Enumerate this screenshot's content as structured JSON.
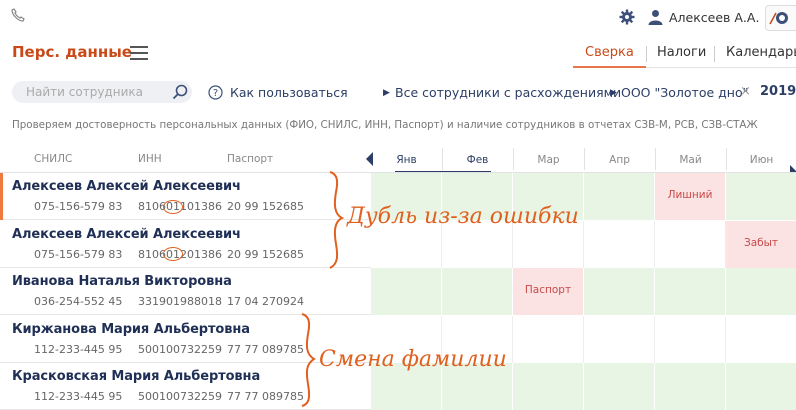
{
  "header": {
    "phone_icon": "phone-icon",
    "user_name": "Алексеев А.А.",
    "settings_icon": "gear-icon",
    "user_icon": "user-icon"
  },
  "nav": {
    "title": "Перс. данные",
    "tabs": [
      {
        "label": "Сверка",
        "active": true
      },
      {
        "label": "Налоги",
        "active": false
      },
      {
        "label": "Календарь",
        "active": false
      }
    ]
  },
  "toolbar": {
    "search_placeholder": "Найти сотрудника",
    "howto_label": "Как пользоваться",
    "filter_label": "Все сотрудники с расхождениями",
    "org_label": "ООО \"Золотое дно\"",
    "clear_symbol": "×",
    "year": "2019"
  },
  "description": "Проверяем достоверность персональных данных (ФИО, СНИЛС, ИНН, Паспорт) и наличие сотрудников в отчетах СЗВ-М, РСВ, СЗВ-СТАЖ",
  "table": {
    "columns": {
      "snils": "СНИЛС",
      "inn": "ИНН",
      "passport": "Паспорт"
    },
    "months": [
      "Янв",
      "Фев",
      "Мар",
      "Апр",
      "Май",
      "Июн"
    ],
    "rows": [
      {
        "name": "Алексеев Алексей Алексеевич",
        "snils": "075-156-579 83",
        "inn": "810601101386",
        "passport": "20 99 152685",
        "cells": [
          "green",
          "green",
          "green",
          "green",
          "red",
          "green"
        ],
        "labels": [
          "",
          "",
          "",
          "",
          "Лишний",
          ""
        ]
      },
      {
        "name": "Алексеев Алексей Алексеевич",
        "snils": "075-156-579 83",
        "inn": "810601201386",
        "passport": "20 99 152685",
        "cells": [
          "white",
          "white",
          "white",
          "white",
          "white",
          "red"
        ],
        "labels": [
          "",
          "",
          "",
          "",
          "",
          "Забыт"
        ]
      },
      {
        "name": "Иванова Наталья Викторовна",
        "snils": "036-254-552 45",
        "inn": "331901988018",
        "passport": "17 04 270924",
        "cells": [
          "green",
          "green",
          "red",
          "green",
          "green",
          "green"
        ],
        "labels": [
          "",
          "",
          "Паспорт",
          "",
          "",
          ""
        ]
      },
      {
        "name": "Киржанова Мария Альбертовна",
        "snils": "112-233-445 95",
        "inn": "500100732259",
        "passport": "77 77 089785",
        "cells": [
          "white",
          "white",
          "white",
          "white",
          "white",
          "white"
        ],
        "labels": [
          "",
          "",
          "",
          "",
          "",
          ""
        ]
      },
      {
        "name": "Красковская Мария Альбертовна",
        "snils": "112-233-445 95",
        "inn": "500100732259",
        "passport": "77 77 089785",
        "cells": [
          "green",
          "green",
          "green",
          "green",
          "green",
          "green"
        ],
        "labels": [
          "",
          "",
          "",
          "",
          "",
          ""
        ]
      }
    ]
  },
  "annotations": {
    "duplicate_note": "Дубль из-за ошибки",
    "surname_note": "Смена фамилии"
  },
  "colors": {
    "accent": "#c94a18",
    "navy": "#1f2f55",
    "green_cell": "#e8f4e4",
    "red_cell": "#fbe3e3",
    "annotation": "#e0601f"
  }
}
